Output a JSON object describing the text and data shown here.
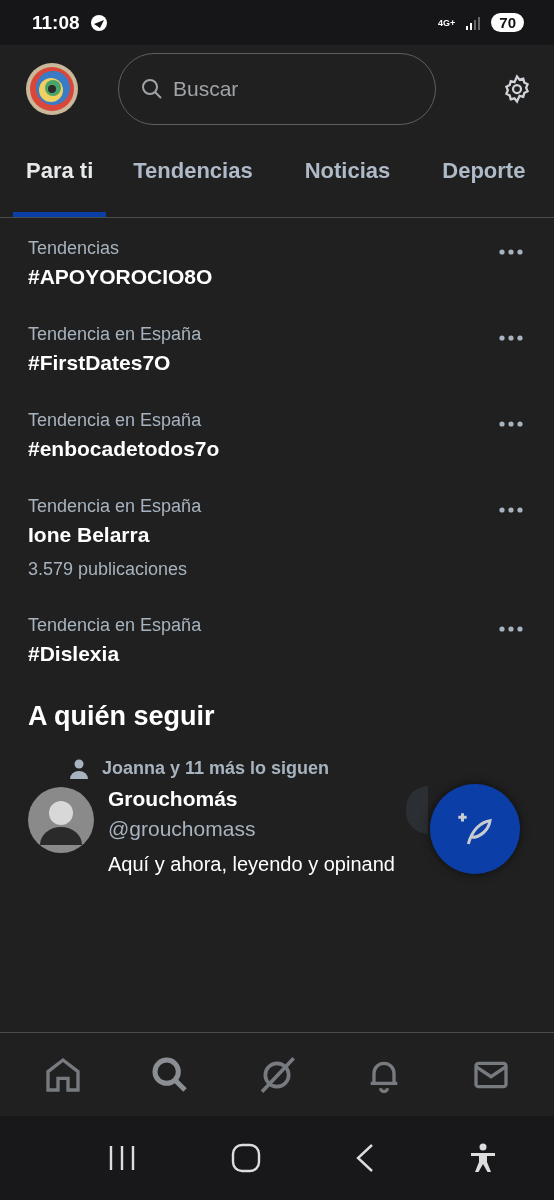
{
  "status_bar": {
    "time": "11:08",
    "network": "4G+",
    "battery": "70"
  },
  "header": {
    "search": {
      "placeholder": "Buscar"
    }
  },
  "tabs": [
    {
      "label": "Para ti",
      "selected": true
    },
    {
      "label": "Tendencias",
      "selected": false
    },
    {
      "label": "Noticias",
      "selected": false
    },
    {
      "label": "Deporte",
      "selected": false
    }
  ],
  "trends": [
    {
      "context": "Tendencias",
      "title": "#APOYOROCIO8O"
    },
    {
      "context": "Tendencia en España",
      "title": "#FirstDates7O"
    },
    {
      "context": "Tendencia en España",
      "title": "#enbocadetodos7o"
    },
    {
      "context": "Tendencia en España",
      "title": "Ione Belarra",
      "count": "3.579 publicaciones"
    },
    {
      "context": "Tendencia en España",
      "title": "#Dislexia"
    }
  ],
  "who_to_follow": {
    "heading": "A quién seguir",
    "suggestions": [
      {
        "social_context": "Joanna y 11 más lo siguen",
        "name": "Grouchomás",
        "handle": "@grouchomass",
        "bio": "Aquí y ahora, leyendo y opinand"
      }
    ]
  },
  "bottom_nav": [
    {
      "kind": "home",
      "selected": false
    },
    {
      "kind": "search",
      "selected": true
    },
    {
      "kind": "grok",
      "selected": false
    },
    {
      "kind": "bell",
      "selected": false
    },
    {
      "kind": "mail",
      "selected": false
    }
  ]
}
